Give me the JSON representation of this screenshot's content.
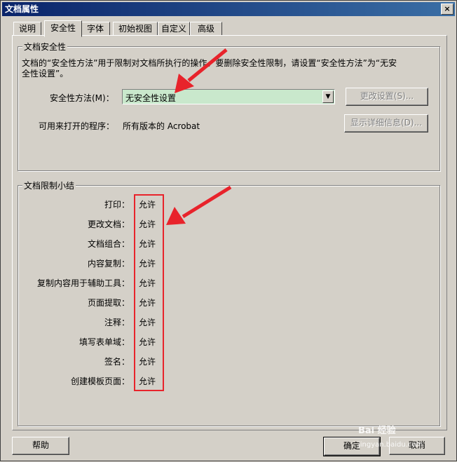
{
  "window": {
    "title": "文档属性",
    "close": "×"
  },
  "tabs": [
    {
      "label": "说明"
    },
    {
      "label": "安全性"
    },
    {
      "label": "字体"
    },
    {
      "label": "初始视图"
    },
    {
      "label": "自定义"
    },
    {
      "label": "高级"
    }
  ],
  "active_tab": "安全性",
  "security": {
    "group_title": "文档安全性",
    "description": "文档的“安全性方法”用于限制对文档所执行的操作。要删除安全性限制，请设置“安全性方法”为“无安全性设置”。",
    "method_label": "安全性方法(M)：",
    "method_value": "无安全性设置",
    "change_settings_btn": "更改设置(S)...",
    "open_with_label": "可用来打开的程序：",
    "open_with_value": "所有版本的 Acrobat",
    "show_details_btn": "显示详细信息(D)..."
  },
  "restrictions": {
    "group_title": "文档限制小结",
    "items": [
      {
        "label": "打印：",
        "value": "允许"
      },
      {
        "label": "更改文档：",
        "value": "允许"
      },
      {
        "label": "文档组合：",
        "value": "允许"
      },
      {
        "label": "内容复制：",
        "value": "允许"
      },
      {
        "label": "复制内容用于辅助工具：",
        "value": "允许"
      },
      {
        "label": "页面提取：",
        "value": "允许"
      },
      {
        "label": "注释：",
        "value": "允许"
      },
      {
        "label": "填写表单域：",
        "value": "允许"
      },
      {
        "label": "签名：",
        "value": "允许"
      },
      {
        "label": "创建模板页面：",
        "value": "允许"
      }
    ]
  },
  "footer": {
    "help": "帮助",
    "ok": "确定",
    "cancel": "取消"
  },
  "annotation": {
    "highlight_color": "#e8232b"
  },
  "watermark": {
    "text": "Bai 经验",
    "url": "jingyan.baidu.com"
  }
}
